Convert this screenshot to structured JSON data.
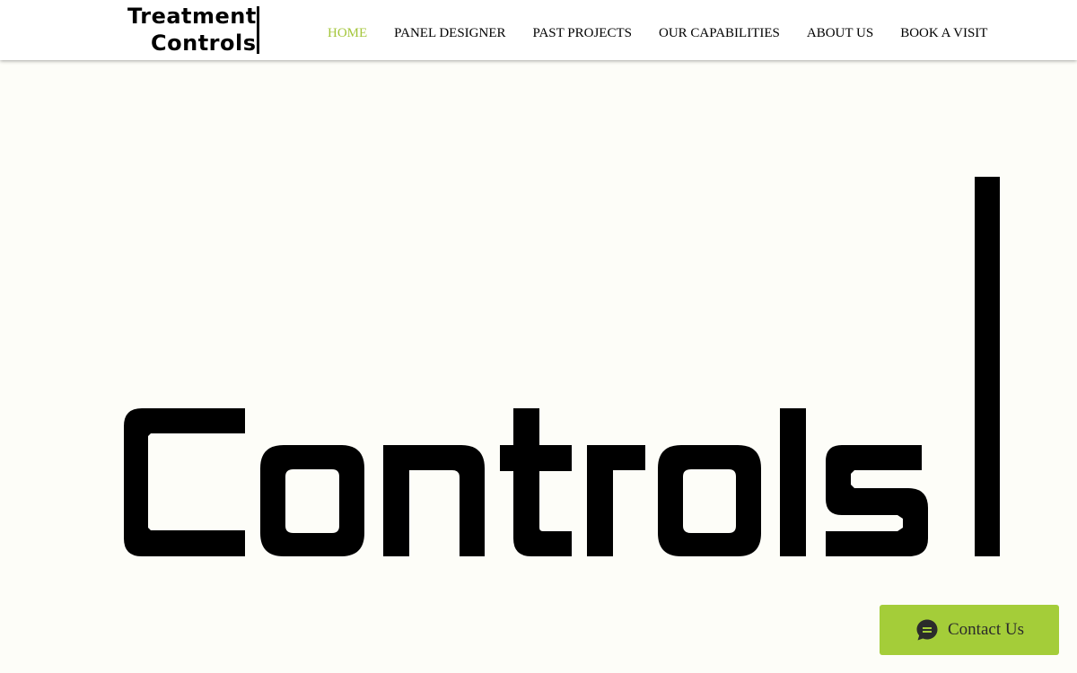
{
  "header": {
    "logo": {
      "line1": "Treatment",
      "line2": "Controls"
    },
    "nav": [
      {
        "label": "HOME",
        "active": true
      },
      {
        "label": "PANEL DESIGNER",
        "active": false
      },
      {
        "label": "PAST PROJECTS",
        "active": false
      },
      {
        "label": "OUR CAPABILITIES",
        "active": false
      },
      {
        "label": "ABOUT US",
        "active": false
      },
      {
        "label": "BOOK A VISIT",
        "active": false
      }
    ]
  },
  "hero": {
    "wordmark": "Controls"
  },
  "chat_widget": {
    "label": "Contact Us",
    "icon": "chat-bubble-icon"
  },
  "colors": {
    "accent": "#a4c63b",
    "widget_bg": "#a4cd39",
    "page_bg": "#fdfdf8",
    "text": "#000000"
  }
}
